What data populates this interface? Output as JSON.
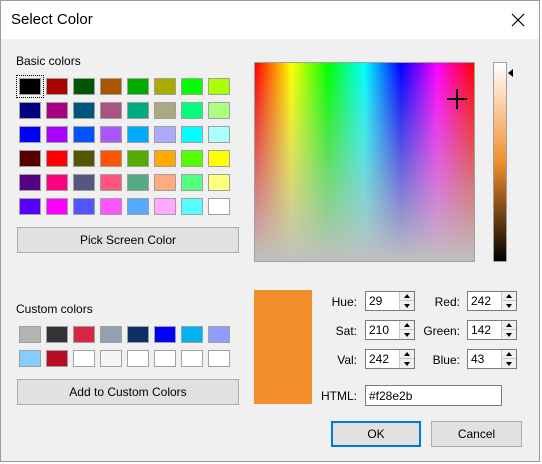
{
  "title": "Select Color",
  "basic_colors_label": "Basic colors",
  "basic_colors": [
    "#000000",
    "#aa0000",
    "#005500",
    "#aa5500",
    "#00aa00",
    "#aaaa00",
    "#00ff00",
    "#aaff00",
    "#000080",
    "#aa007f",
    "#00557f",
    "#aa557f",
    "#00aa7f",
    "#aaaa7f",
    "#00ff7f",
    "#aaff7f",
    "#0000ff",
    "#aa00ff",
    "#0055ff",
    "#aa55ff",
    "#00aaff",
    "#aaaaff",
    "#00ffff",
    "#aaffff",
    "#550000",
    "#ff0000",
    "#555500",
    "#ff5500",
    "#55aa00",
    "#ffaa00",
    "#55ff00",
    "#ffff00",
    "#550080",
    "#ff007f",
    "#55557f",
    "#ff557f",
    "#55aa7f",
    "#ffaa7f",
    "#55ff7f",
    "#ffff7f",
    "#5500ff",
    "#ff00ff",
    "#5555ff",
    "#ff55ff",
    "#55aaff",
    "#ffaaff",
    "#55ffff",
    "#ffffff"
  ],
  "selected_basic_index": 0,
  "pick_screen_label": "Pick Screen Color",
  "custom_colors_label": "Custom colors",
  "custom_colors": [
    "#b4b4b4",
    "#333333",
    "#d7263d",
    "#93a1b0",
    "#0c2f66",
    "#0000ff",
    "#00b2ee",
    "#8e9cff",
    "#88ccff",
    "#b80d20",
    "#ffffff",
    "#f5f5f5",
    "#ffffff",
    "#ffffff",
    "#ffffff",
    "#ffffff"
  ],
  "add_custom_label": "Add to Custom Colors",
  "current_color": "#f28e2b",
  "fields": {
    "hue_label": "Hue:",
    "hue": "29",
    "sat_label": "Sat:",
    "sat": "210",
    "val_label": "Val:",
    "val": "242",
    "red_label": "Red:",
    "red": "242",
    "green_label": "Green:",
    "green": "142",
    "blue_label": "Blue:",
    "blue": "43",
    "html_label": "HTML:",
    "html": "#f28e2b"
  },
  "ok_label": "OK",
  "cancel_label": "Cancel"
}
